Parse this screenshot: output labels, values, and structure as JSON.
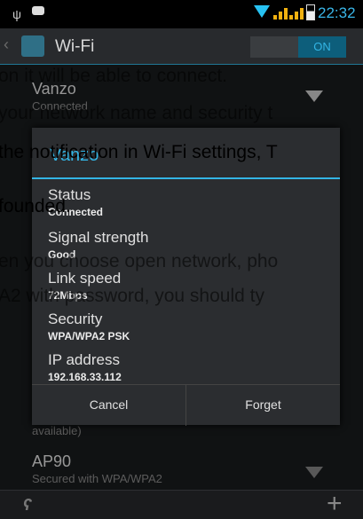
{
  "status_bar": {
    "time": "22:32"
  },
  "action_bar": {
    "title": "Wi-Fi",
    "toggle_label": "ON"
  },
  "networks": [
    {
      "name": "Vanzo",
      "status": "Connected"
    },
    {
      "name": "",
      "status": "available)"
    },
    {
      "name": "AP90",
      "status": "Secured with WPA/WPA2"
    }
  ],
  "dialog": {
    "title": "Vanzo",
    "fields": [
      {
        "label": "Status",
        "value": "Connected"
      },
      {
        "label": "Signal strength",
        "value": "Good"
      },
      {
        "label": "Link speed",
        "value": "72Mbps"
      },
      {
        "label": "Security",
        "value": "WPA/WPA2 PSK"
      },
      {
        "label": "IP address",
        "value": "192.168.33.112"
      }
    ],
    "cancel_label": "Cancel",
    "forget_label": "Forget"
  },
  "overlay_text": {
    "line1": "on it will be able to connect.",
    "line2": "your network name and security t",
    "line3": "the notification in  Wi-Fi settings, T",
    "line4": "founded.",
    "line5": "en you choose open network, pho",
    "line6": "A2 with password, you should ty"
  }
}
